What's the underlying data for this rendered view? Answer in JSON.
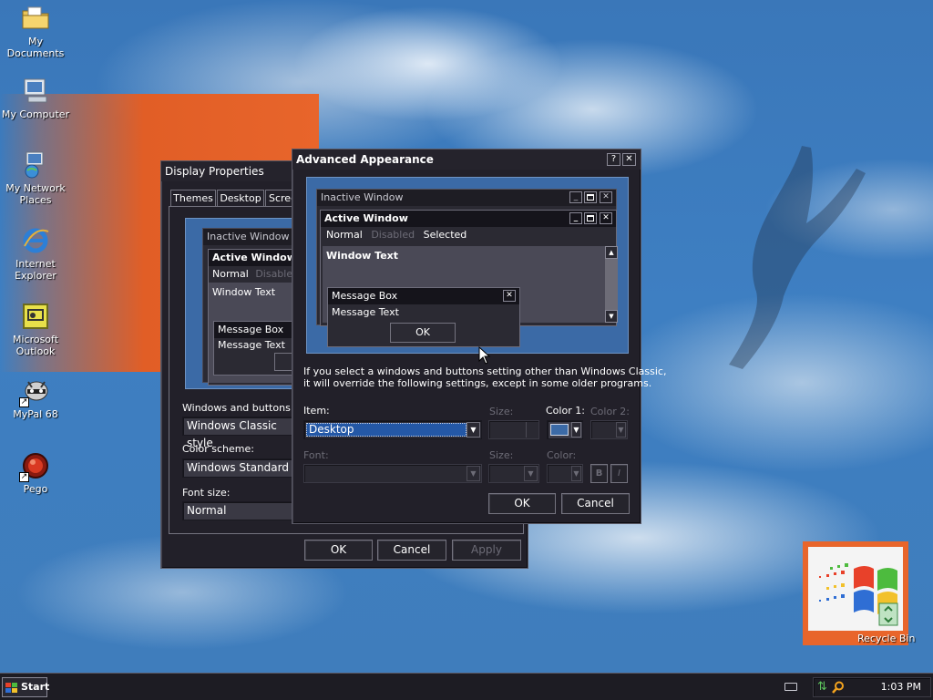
{
  "desktop": {
    "icons": [
      {
        "label": "My Documents",
        "icon": "folder-documents-icon"
      },
      {
        "label": "My Computer",
        "icon": "computer-icon"
      },
      {
        "label": "My Network Places",
        "icon": "network-places-icon"
      },
      {
        "label": "Internet Explorer",
        "icon": "internet-explorer-icon"
      },
      {
        "label": "Microsoft Outlook",
        "icon": "outlook-icon"
      },
      {
        "label": "MyPal 68",
        "icon": "mypal-icon"
      },
      {
        "label": "Pego",
        "icon": "pego-icon"
      }
    ],
    "recycle_bin": {
      "label": "Recycle Bin",
      "icon": "recycle-bin-icon"
    }
  },
  "display_properties": {
    "title": "Display Properties",
    "tabs": [
      "Themes",
      "Desktop",
      "Scree"
    ],
    "preview": {
      "inactive_title": "Inactive Window",
      "active_title": "Active Window",
      "menu_normal": "Normal",
      "menu_disabled": "Disabled",
      "window_text": "Window Text",
      "msgbox_title": "Message Box",
      "msgbox_text": "Message Text"
    },
    "windows_buttons_label": "Windows and buttons:",
    "windows_buttons_value": "Windows Classic style",
    "color_scheme_label": "Color scheme:",
    "color_scheme_value": "Windows Standard",
    "font_size_label": "Font size:",
    "font_size_value": "Normal",
    "ok_label": "OK",
    "cancel_label": "Cancel",
    "apply_label": "Apply"
  },
  "advanced_appearance": {
    "title": "Advanced Appearance",
    "help_glyph": "?",
    "close_glyph": "✕",
    "preview": {
      "inactive_title": "Inactive Window",
      "active_title": "Active Window",
      "menu_normal": "Normal",
      "menu_disabled": "Disabled",
      "menu_selected": "Selected",
      "window_text": "Window Text",
      "msgbox_title": "Message Box",
      "msgbox_text": "Message Text",
      "msgbox_ok": "OK"
    },
    "info_text_line1": "If you select a windows and buttons setting other than Windows Classic,",
    "info_text_line2": "it will override the following settings, except in some older programs.",
    "item_label": "Item:",
    "item_value": "Desktop",
    "size_label": "Size:",
    "color1_label": "Color 1:",
    "color2_label": "Color 2:",
    "font_label": "Font:",
    "font_size_label": "Size:",
    "font_color_label": "Color:",
    "bold_glyph": "B",
    "italic_glyph": "I",
    "ok_label": "OK",
    "cancel_label": "Cancel",
    "color1_swatch": "#3b6aa6"
  },
  "taskbar": {
    "start_label": "Start",
    "clock": "1:03 PM"
  }
}
